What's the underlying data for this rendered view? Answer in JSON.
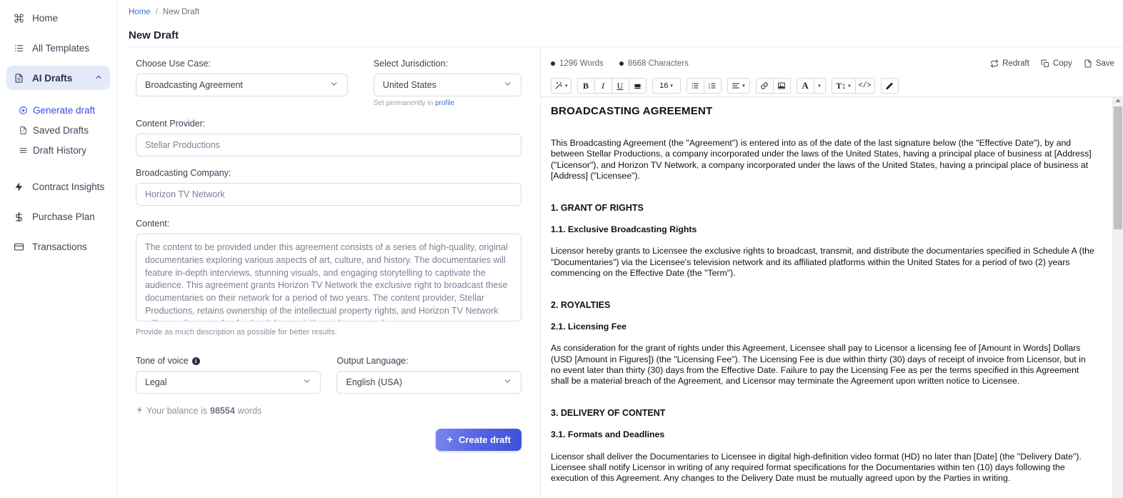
{
  "sidebar": {
    "items": [
      {
        "label": "Home",
        "icon": "command-icon"
      },
      {
        "label": "All Templates",
        "icon": "list-icon"
      },
      {
        "label": "AI Drafts",
        "icon": "document-icon",
        "chevron": "⌃"
      }
    ],
    "sub_items": [
      {
        "label": "Generate draft",
        "icon": "plus-circle-icon"
      },
      {
        "label": "Saved Drafts",
        "icon": "saved-document-icon"
      },
      {
        "label": "Draft History",
        "icon": "history-lines-icon"
      }
    ],
    "lower_items": [
      {
        "label": "Contract Insights",
        "icon": "bolt-icon"
      },
      {
        "label": "Purchase Plan",
        "icon": "dollar-icon"
      },
      {
        "label": "Transactions",
        "icon": "card-icon"
      }
    ]
  },
  "breadcrumb": {
    "home": "Home",
    "separator": "/",
    "current": "New Draft"
  },
  "page_title": "New Draft",
  "form": {
    "use_case": {
      "label": "Choose Use Case:",
      "value": "Broadcasting Agreement",
      "options": [
        "Broadcasting Agreement"
      ]
    },
    "jurisdiction": {
      "label": "Select Jurisdiction:",
      "value": "United States",
      "options": [
        "United States"
      ],
      "helper_prefix": "Set permanently in ",
      "helper_link": "profile"
    },
    "content_provider": {
      "label": "Content Provider:",
      "value": "Stellar Productions",
      "placeholder": "Stellar Productions"
    },
    "broadcasting_company": {
      "label": "Broadcasting Company:",
      "value": "Horizon TV Network",
      "placeholder": "Horizon TV Network"
    },
    "content": {
      "label": "Content:",
      "value": "The content to be provided under this agreement consists of a series of high-quality, original documentaries exploring various aspects of art, culture, and history. The documentaries will feature in-depth interviews, stunning visuals, and engaging storytelling to captivate the audience. This agreement grants Horizon TV Network the exclusive right to broadcast these documentaries on their network for a period of two years. The content provider, Stellar Productions, retains ownership of the intellectual property rights, and Horizon TV Network will pay a licensing fee for the rights to air these documentaries.",
      "note": "Provide as much description as possible for better results."
    },
    "tone": {
      "label": "Tone of voice",
      "info": "i",
      "value": "Legal",
      "options": [
        "Legal"
      ]
    },
    "language": {
      "label": "Output Language:",
      "value": "English (USA)",
      "options": [
        "English (USA)"
      ]
    },
    "balance": {
      "prefix": "Your balance is",
      "amount": "98554",
      "suffix": "words"
    },
    "create_button": {
      "label": "Create draft",
      "plus": "+"
    }
  },
  "editor": {
    "word_count": "1296 Words",
    "char_count": "8668 Characters",
    "actions": [
      {
        "label": "Redraft",
        "icon": "redraft-icon"
      },
      {
        "label": "Copy",
        "icon": "copy-icon"
      },
      {
        "label": "Save",
        "icon": "save-file-icon"
      }
    ],
    "toolbar": {
      "magic": {
        "icon": "magic-wand-icon",
        "caret": "▾"
      },
      "bold": "B",
      "italic": "I",
      "underline": "U",
      "highlight_icon": "highlighter-icon",
      "font_size": "16",
      "font_size_caret": "▾",
      "bullet_list_icon": "bullet-list-icon",
      "numbered_list_icon": "numbered-list-icon",
      "align_icon": "align-left-icon",
      "align_caret": "▾",
      "link_icon": "link-icon",
      "image_icon": "image-icon",
      "font_color": "A",
      "font_color_caret": "▾",
      "text_style": "T↕",
      "text_style_caret": "▾",
      "code_icon": "</>",
      "eraser_icon": "eraser-icon"
    },
    "document": {
      "title": "BROADCASTING AGREEMENT",
      "intro": "This Broadcasting Agreement (the \"Agreement\") is entered into as of the date of the last signature below (the \"Effective Date\"), by and between Stellar Productions, a company incorporated under the laws of the United States, having a principal place of business at [Address] (\"Licensor\"), and Horizon TV Network, a company incorporated under the laws of the United States, having a principal place of business at [Address] (\"Licensee\").",
      "s1_heading": "1. GRANT OF RIGHTS",
      "s1_1_heading": "1.1. Exclusive Broadcasting Rights",
      "s1_1_body": "Licensor hereby grants to Licensee the exclusive rights to broadcast, transmit, and distribute the documentaries specified in Schedule A (the \"Documentaries\") via the Licensee's television network and its affiliated platforms within the United States for a period of two (2) years commencing on the Effective Date (the \"Term\").",
      "s2_heading": "2. ROYALTIES",
      "s2_1_heading": "2.1. Licensing Fee",
      "s2_1_body": "As consideration for the grant of rights under this Agreement, Licensee shall pay to Licensor a licensing fee of [Amount in Words] Dollars (USD [Amount in Figures]) (the \"Licensing Fee\"). The Licensing Fee is due within thirty (30) days of receipt of invoice from Licensor, but in no event later than thirty (30) days from the Effective Date. Failure to pay the Licensing Fee as per the terms specified in this Agreement shall be a material breach of the Agreement, and Licensor may terminate the Agreement upon written notice to Licensee.",
      "s3_heading": "3. DELIVERY OF CONTENT",
      "s3_1_heading": "3.1. Formats and Deadlines",
      "s3_1_body": "Licensor shall deliver the Documentaries to Licensee in digital high-definition video format (HD) no later than [Date] (the \"Delivery Date\"). Licensee shall notify Licensor in writing of any required format specifications for the Documentaries within ten (10) days following the execution of this Agreement. Any changes to the Delivery Date must be mutually agreed upon by the Parties in writing."
    }
  },
  "colors": {
    "accent": "#3b4ee0",
    "active_nav_bg": "#e3e8fb",
    "link": "#3b6fe0",
    "button_gradient_start": "#7b86ec",
    "button_gradient_end": "#3d4fd9"
  }
}
